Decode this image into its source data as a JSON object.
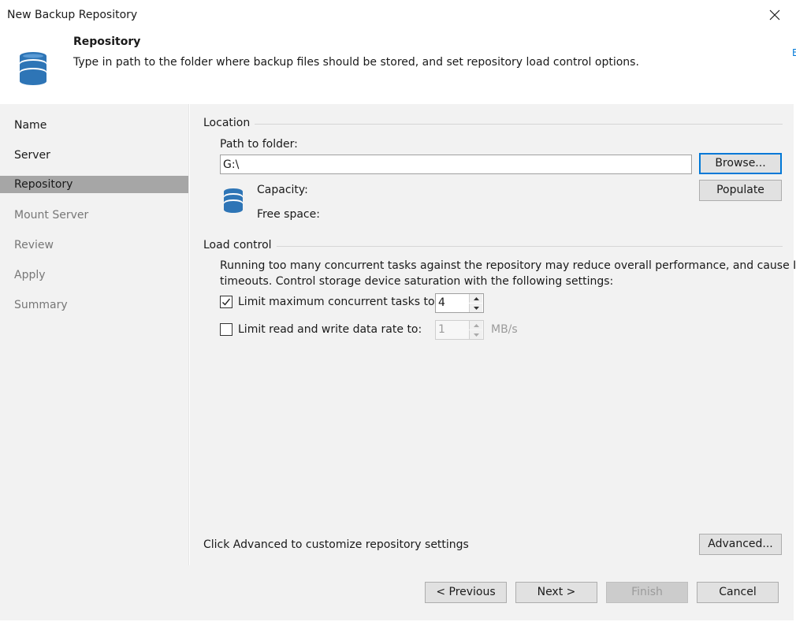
{
  "window": {
    "title": "New Backup Repository"
  },
  "header": {
    "title": "Repository",
    "description": "Type in path to the folder where backup files should be stored, and set repository load control options.",
    "icon": "database-icon"
  },
  "sidebar": {
    "items": [
      {
        "label": "Name",
        "state": "done"
      },
      {
        "label": "Server",
        "state": "done"
      },
      {
        "label": "Repository",
        "state": "active"
      },
      {
        "label": "Mount Server",
        "state": "pending"
      },
      {
        "label": "Review",
        "state": "pending"
      },
      {
        "label": "Apply",
        "state": "pending"
      },
      {
        "label": "Summary",
        "state": "pending"
      }
    ]
  },
  "location": {
    "group_label": "Location",
    "path_label": "Path to folder:",
    "path_value": "G:\\",
    "browse_label": "Browse...",
    "populate_label": "Populate",
    "capacity_label": "Capacity:",
    "free_space_label": "Free space:"
  },
  "load_control": {
    "group_label": "Load control",
    "description_line1": "Running too many concurrent tasks against the repository may reduce overall performance, and cause I/O",
    "description_line2": "timeouts. Control storage device saturation with the following settings:",
    "limit_tasks": {
      "label": "Limit maximum concurrent tasks to:",
      "checked": true,
      "value": "4"
    },
    "limit_rate": {
      "label": "Limit read and write data rate to:",
      "checked": false,
      "value": "1",
      "unit": "MB/s"
    }
  },
  "advanced": {
    "hint": "Click Advanced to customize repository settings",
    "button_label": "Advanced..."
  },
  "footer": {
    "previous_label": "< Previous",
    "next_label": "Next >",
    "finish_label": "Finish",
    "cancel_label": "Cancel"
  },
  "edge": {
    "text": "E"
  },
  "colors": {
    "accent": "#0078d7",
    "panel": "#f2f2f2",
    "active_step": "#a6a6a6",
    "database_icon": "#2e75b6"
  }
}
